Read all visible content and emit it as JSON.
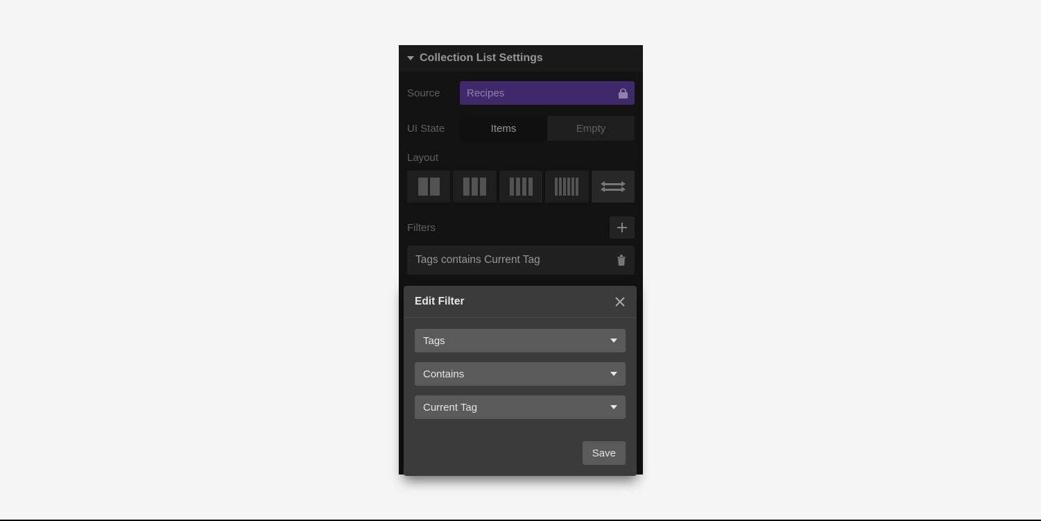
{
  "header": {
    "title": "Collection List Settings"
  },
  "source": {
    "label": "Source",
    "value": "Recipes",
    "locked": true
  },
  "ui_state": {
    "label": "UI State",
    "options": [
      "Items",
      "Empty"
    ],
    "active": "Items"
  },
  "layout": {
    "label": "Layout",
    "active_index": 4,
    "options": [
      "2-col",
      "3-col",
      "4-col",
      "6-col",
      "full-width"
    ]
  },
  "filters": {
    "label": "Filters",
    "items": [
      {
        "text": "Tags contains Current Tag"
      }
    ]
  },
  "popover": {
    "title": "Edit Filter",
    "field": "Tags",
    "operator": "Contains",
    "value": "Current Tag",
    "save_label": "Save"
  }
}
